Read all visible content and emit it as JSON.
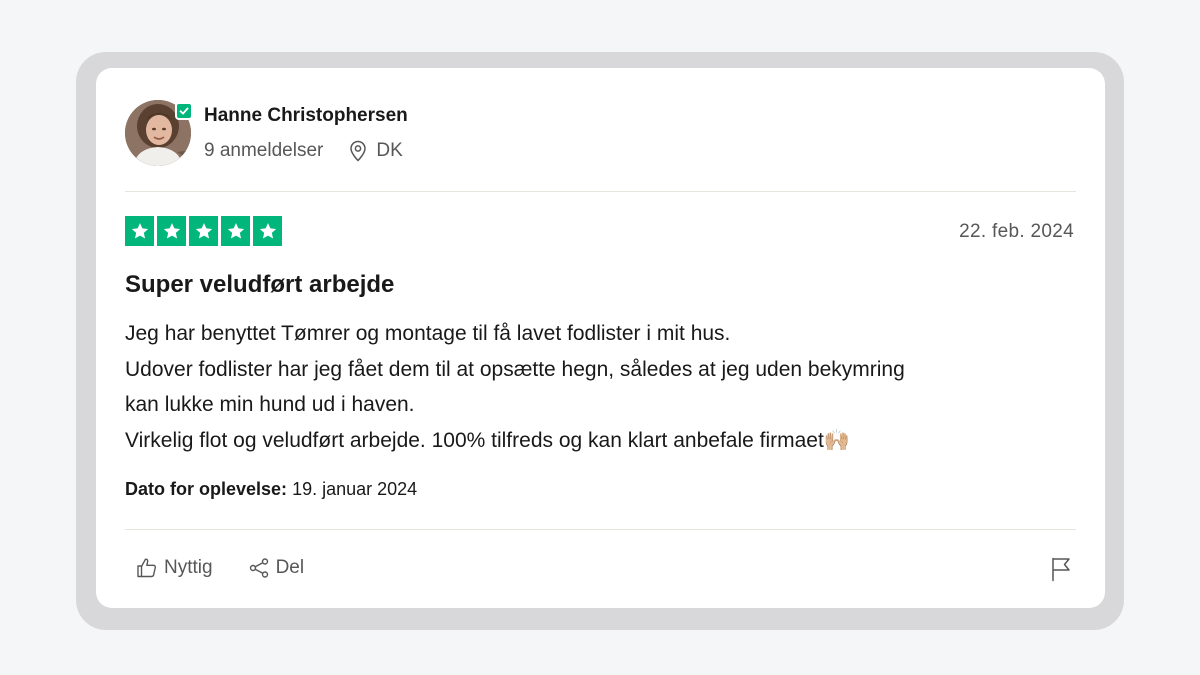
{
  "reviewer": {
    "name": "Hanne Christophersen",
    "review_count": "9 anmeldelser",
    "location": "DK",
    "verified": true
  },
  "review": {
    "rating": 5,
    "rating_max": 5,
    "date": "22. feb. 2024",
    "title": "Super veludført arbejde",
    "body_lines": [
      "Jeg har benyttet Tømrer og montage til få lavet fodlister i mit hus.",
      "Udover fodlister har jeg fået dem til at opsætte hegn, således at jeg uden bekymring",
      "kan lukke min hund ud i haven.",
      "Virkelig flot og veludført arbejde. 100% tilfreds og kan klart anbefale firmaet🙌🏼"
    ],
    "experience_label": "Dato for oplevelse:",
    "experience_date": "19. januar 2024"
  },
  "actions": {
    "useful_label": "Nyttig",
    "share_label": "Del"
  },
  "icons": {
    "avatar": "avatar-photo",
    "verified": "verified-check-icon",
    "location": "location-pin-icon",
    "star": "star-icon",
    "useful": "thumbs-up-icon",
    "share": "share-icon",
    "report": "flag-icon"
  },
  "colors": {
    "star_green": "#00b67a",
    "text_primary": "#191919",
    "text_secondary": "#575757",
    "page_background": "#f5f6f8",
    "frame": "#d8d8da"
  }
}
